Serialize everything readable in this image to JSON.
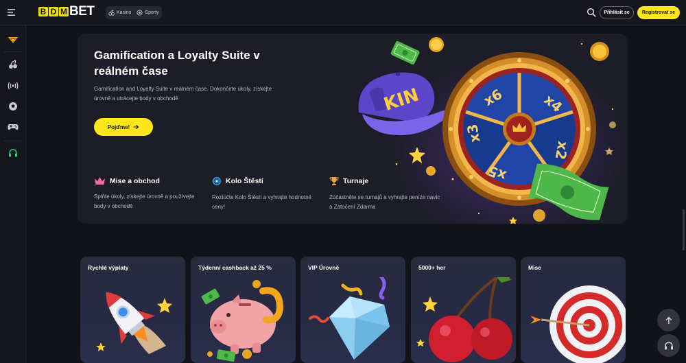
{
  "header": {
    "logo_prefix": "BDM",
    "logo_letters": [
      "B",
      "D",
      "M"
    ],
    "logo_suffix": "BET",
    "categories": [
      {
        "label": "Kasino",
        "icon": "cherry-icon"
      },
      {
        "label": "Sporty",
        "icon": "ball-icon"
      }
    ],
    "login_label": "Přihlásit se",
    "register_label": "Registrovat se"
  },
  "sidebar": {
    "items": [
      {
        "icon": "kingdom-badge-icon"
      },
      {
        "icon": "cherry-icon"
      },
      {
        "icon": "live-broadcast-icon"
      },
      {
        "icon": "football-icon"
      },
      {
        "icon": "gamepad-icon"
      },
      {
        "icon": "headset-icon"
      }
    ]
  },
  "hero": {
    "title": "Gamification a Loyalty Suite v reálném čase",
    "description": "Gamification and Loyalty Suite v reálném čase. Dokončete úkoly, získejte úrovně a utrácejte body v obchodě",
    "cta_label": "Pojďme!",
    "features": [
      {
        "title": "Mise a obchod",
        "text": "Splňte úkoly, získejte úrovně a používejte body v obchodě",
        "icon": "crown-icon"
      },
      {
        "title": "Kolo Štěstí",
        "text": "Roztočte Kolo Štěstí a vyhrajte hodnotné ceny!",
        "icon": "wheel-icon"
      },
      {
        "title": "Turnaje",
        "text": "Zúčastněte se turnajů a vyhrajte peníze navíc a Zatočení Zdarma",
        "icon": "trophy-icon"
      }
    ],
    "cap_text": "KIN",
    "wheel_labels": [
      "x6",
      "x4",
      "x2",
      "x5",
      "x3"
    ]
  },
  "promos": [
    {
      "title": "Rychlé výplaty",
      "art": "rocket"
    },
    {
      "title": "Týdenní cashback až 25 %",
      "art": "piggy-bank"
    },
    {
      "title": "VIP Úrovně",
      "art": "diamond"
    },
    {
      "title": "5000+ her",
      "art": "cherries"
    },
    {
      "title": "Mise",
      "art": "target"
    }
  ],
  "colors": {
    "accent": "#ffe61b",
    "background": "#121318",
    "panel": "#1c1d27",
    "muted_text": "#b7b8c4",
    "support_green": "#2ecc71"
  }
}
